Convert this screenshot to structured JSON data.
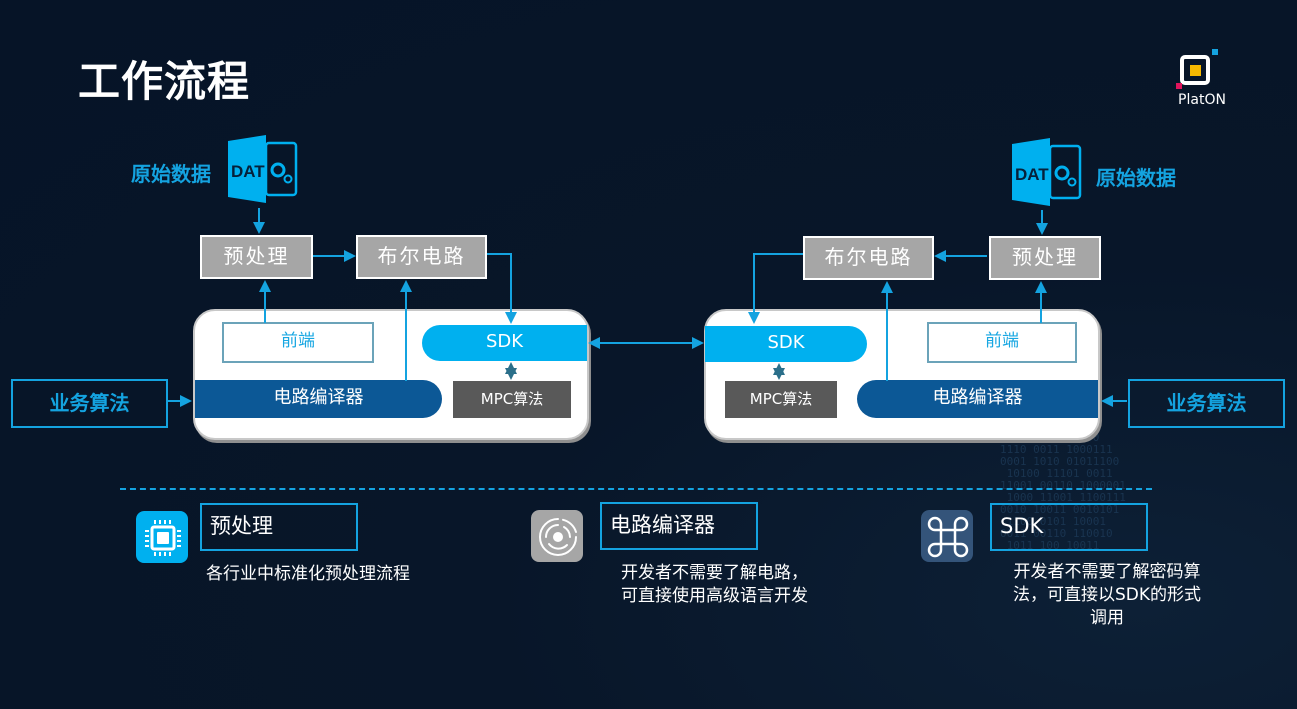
{
  "slide": {
    "title": "工作流程",
    "logo_text": "PlatON",
    "colors": {
      "accent": "#14a3e0",
      "sdk": "#00b0ef",
      "compiler": "#0c5896",
      "mpc": "#595959",
      "gray_box": "#a6a6a6",
      "background": "#061427"
    }
  },
  "left_party": {
    "raw_data_label": "原始数据",
    "raw_data_icon": "DAT",
    "preprocess": "预处理",
    "boolean_circuit": "布尔电路",
    "frontend": "前端",
    "sdk": "SDK",
    "compiler": "电路编译器",
    "mpc": "MPC算法",
    "business_algo": "业务算法"
  },
  "right_party": {
    "raw_data_label": "原始数据",
    "raw_data_icon": "DAT",
    "preprocess": "预处理",
    "boolean_circuit": "布尔电路",
    "frontend": "前端",
    "sdk": "SDK",
    "compiler": "电路编译器",
    "mpc": "MPC算法",
    "business_algo": "业务算法"
  },
  "features": [
    {
      "icon": "chip-icon",
      "title": "预处理",
      "desc": [
        "各行业中标准化预处理流程"
      ]
    },
    {
      "icon": "disc-icon",
      "title": "电路编译器",
      "desc": [
        "开发者不需要了解电路，",
        "可直接使用高级语言开发"
      ]
    },
    {
      "icon": "command-icon",
      "title": "SDK",
      "desc": [
        "开发者不需要了解密码算",
        "法，可直接以SDK的形式",
        "调用"
      ]
    }
  ]
}
